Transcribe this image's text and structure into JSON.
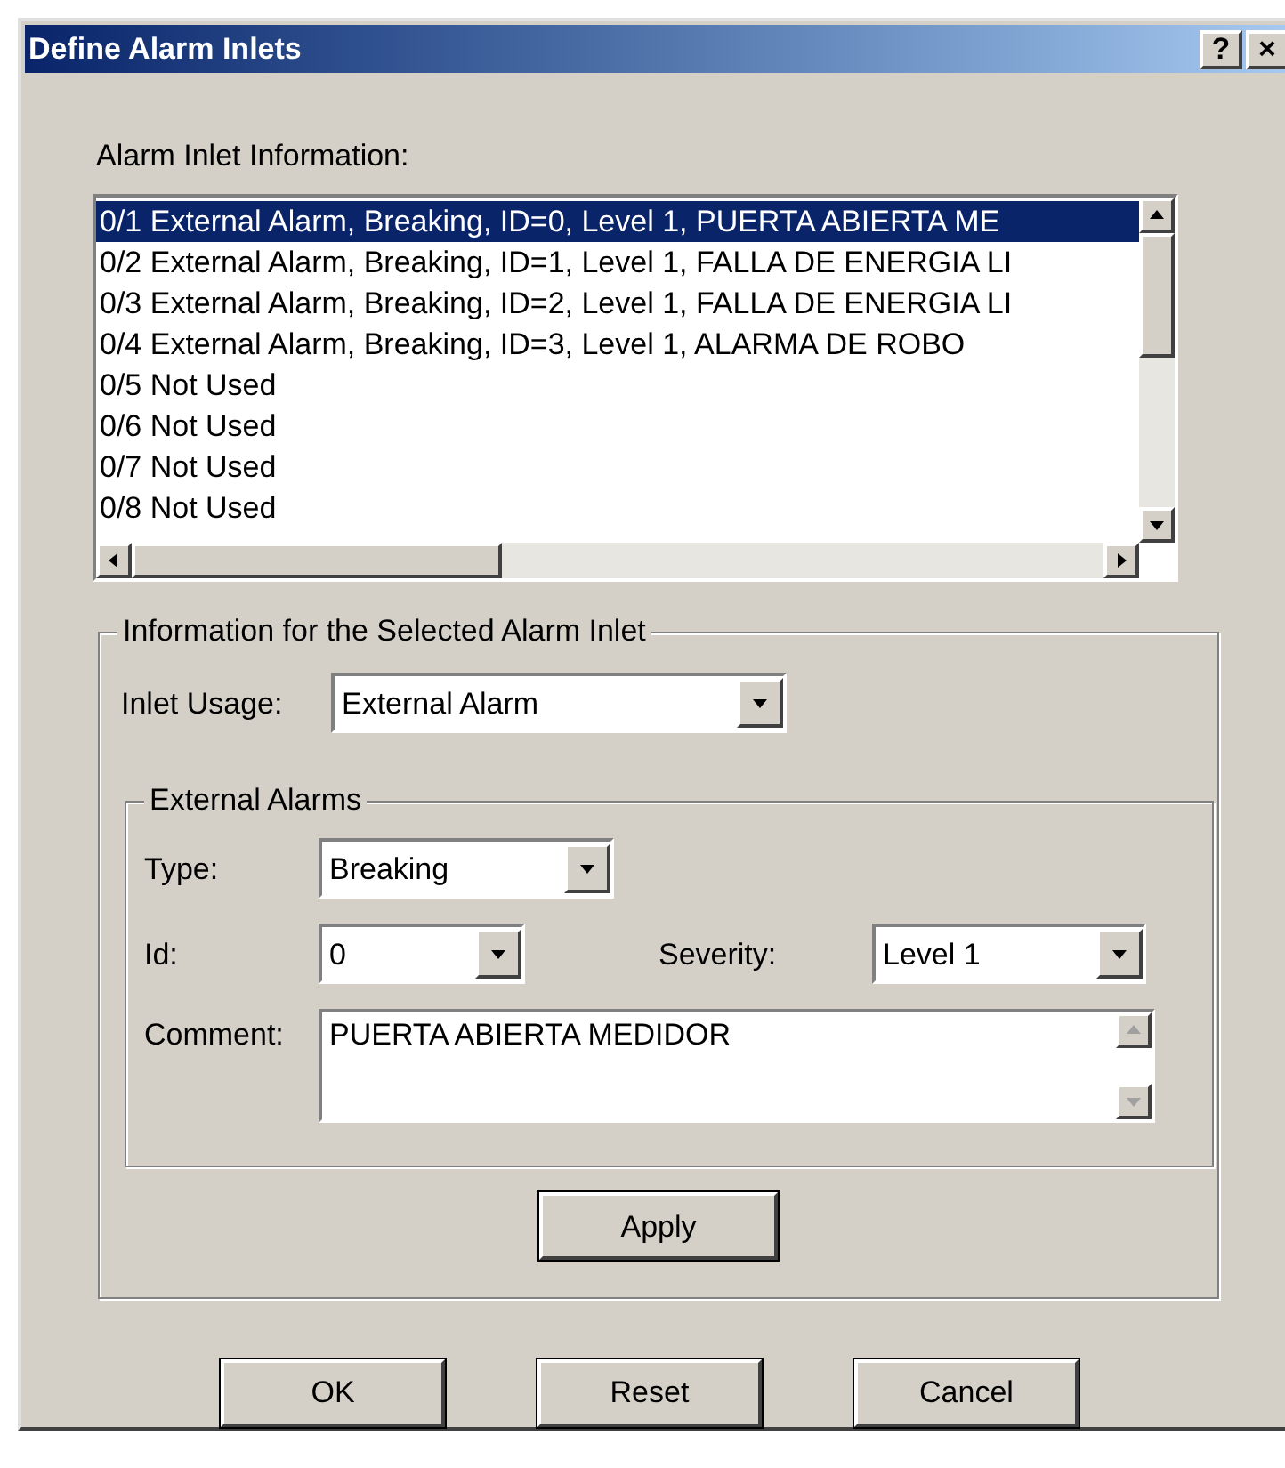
{
  "window": {
    "title": "Define Alarm Inlets",
    "buttons": [
      "?",
      "×"
    ]
  },
  "list": {
    "label": "Alarm Inlet Information:",
    "items": [
      {
        "text": "0/1 External Alarm, Breaking, ID=0, Level 1, PUERTA ABIERTA ME",
        "selected": true
      },
      {
        "text": "0/2 External Alarm, Breaking, ID=1, Level 1, FALLA DE ENERGIA LI",
        "selected": false
      },
      {
        "text": "0/3 External Alarm, Breaking, ID=2, Level 1, FALLA DE ENERGIA LI",
        "selected": false
      },
      {
        "text": "0/4 External Alarm, Breaking, ID=3, Level 1, ALARMA DE ROBO",
        "selected": false
      },
      {
        "text": "0/5 Not Used",
        "selected": false
      },
      {
        "text": "0/6 Not Used",
        "selected": false
      },
      {
        "text": "0/7 Not Used",
        "selected": false
      },
      {
        "text": "0/8 Not Used",
        "selected": false
      }
    ]
  },
  "selected_group": {
    "title": "Information for the Selected Alarm Inlet",
    "inlet_usage": {
      "label": "Inlet Usage:",
      "value": "External Alarm"
    },
    "external_alarms": {
      "title": "External Alarms",
      "type": {
        "label": "Type:",
        "value": "Breaking"
      },
      "id": {
        "label": "Id:",
        "value": "0"
      },
      "severity": {
        "label": "Severity:",
        "value": "Level 1"
      },
      "comment": {
        "label": "Comment:",
        "value": "PUERTA ABIERTA MEDIDOR"
      }
    },
    "apply": "Apply"
  },
  "buttons": [
    "OK",
    "Reset",
    "Cancel"
  ]
}
